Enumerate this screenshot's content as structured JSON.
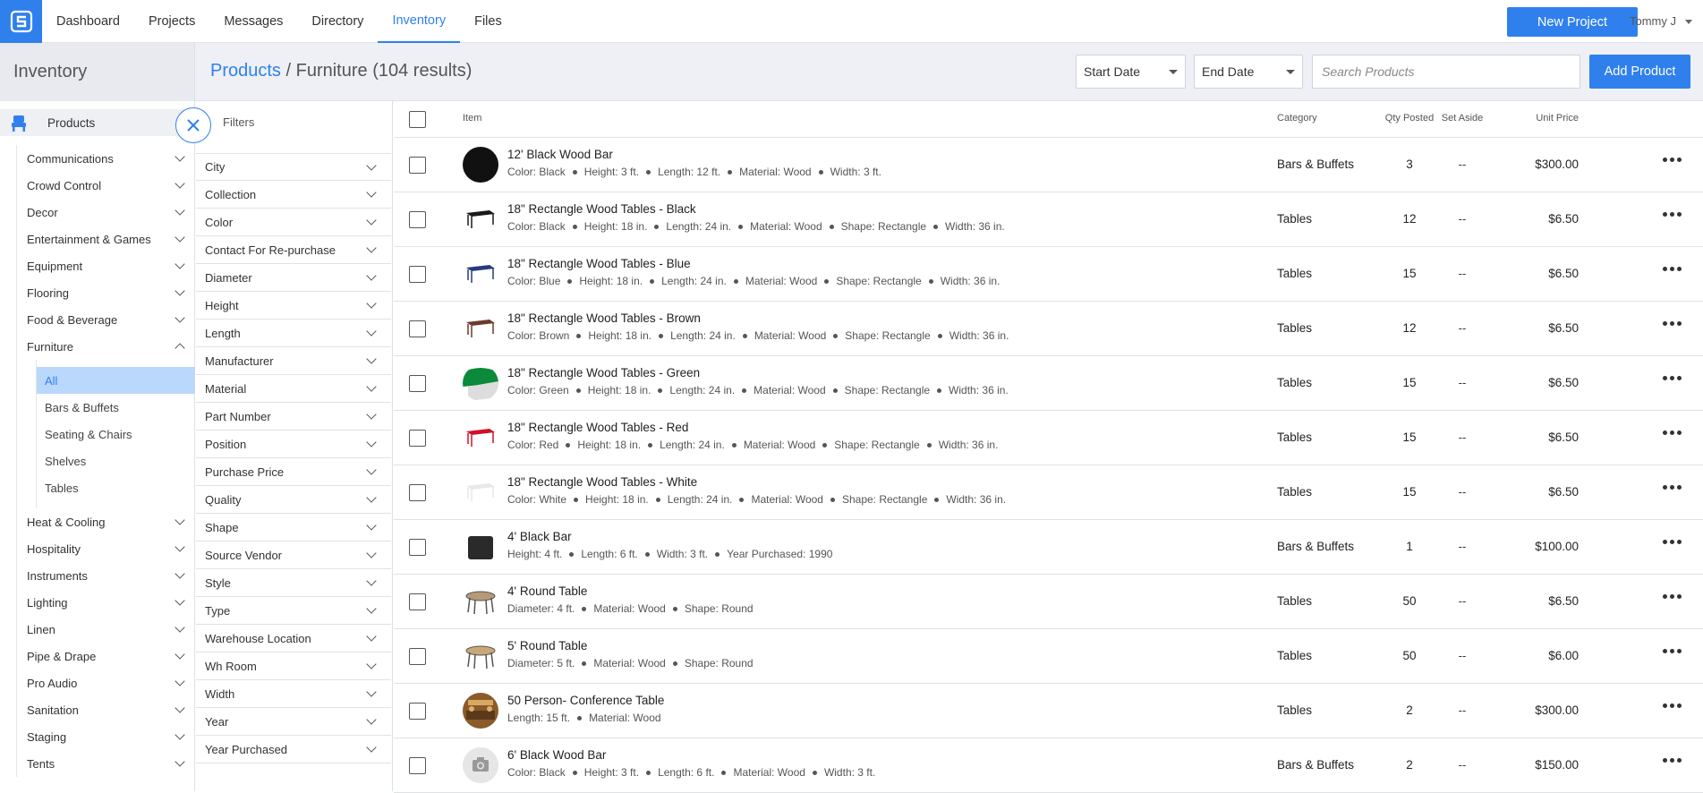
{
  "nav": {
    "items": [
      "Dashboard",
      "Projects",
      "Messages",
      "Directory",
      "Inventory",
      "Files"
    ],
    "active": "Inventory",
    "new_project": "New Project",
    "user": "Tommy J"
  },
  "page": {
    "section_title": "Inventory",
    "breadcrumb_link": "Products",
    "breadcrumb_sep": " / ",
    "breadcrumb_current": "Furniture (104 results)",
    "start_date": "Start Date",
    "end_date": "End Date",
    "search_placeholder": "Search Products",
    "add_product": "Add Product"
  },
  "sidebar": {
    "products_label": "Products",
    "categories_top": [
      "Communications",
      "Crowd Control",
      "Decor",
      "Entertainment & Games",
      "Equipment",
      "Flooring",
      "Food & Beverage",
      "Furniture"
    ],
    "furniture_sub": [
      "All",
      "Bars & Buffets",
      "Seating & Chairs",
      "Shelves",
      "Tables"
    ],
    "categories_bottom": [
      "Heat & Cooling",
      "Hospitality",
      "Instruments",
      "Lighting",
      "Linen",
      "Pipe & Drape",
      "Pro Audio",
      "Sanitation",
      "Staging",
      "Tents"
    ]
  },
  "filters": {
    "title": "Filters",
    "items": [
      "City",
      "Collection",
      "Color",
      "Contact For Re-purchase",
      "Diameter",
      "Height",
      "Length",
      "Manufacturer",
      "Material",
      "Part Number",
      "Position",
      "Purchase Price",
      "Quality",
      "Shape",
      "Source Vendor",
      "Style",
      "Type",
      "Warehouse Location",
      "Wh Room",
      "Width",
      "Year",
      "Year Purchased"
    ]
  },
  "table": {
    "headers": {
      "item": "Item",
      "category": "Category",
      "qty": "Qty Posted",
      "set_aside": "Set Aside",
      "price": "Unit Price"
    },
    "rows": [
      {
        "name": "12' Black Wood Bar",
        "attrs": [
          "Color: Black",
          "Height: 3 ft.",
          "Length: 12 ft.",
          "Material: Wood",
          "Width: 3 ft."
        ],
        "category": "Bars & Buffets",
        "qty": "3",
        "set_aside": "--",
        "price": "$300.00",
        "thumb": "black-bar",
        "color": "#111111"
      },
      {
        "name": "18\" Rectangle Wood Tables - Black",
        "attrs": [
          "Color: Black",
          "Height: 18 in.",
          "Length: 24 in.",
          "Material: Wood",
          "Shape: Rectangle",
          "Width: 36 in."
        ],
        "category": "Tables",
        "qty": "12",
        "set_aside": "--",
        "price": "$6.50",
        "thumb": "table",
        "color": "#1a1a1a"
      },
      {
        "name": "18\" Rectangle Wood Tables - Blue",
        "attrs": [
          "Color: Blue",
          "Height: 18 in.",
          "Length: 24 in.",
          "Material: Wood",
          "Shape: Rectangle",
          "Width: 36 in."
        ],
        "category": "Tables",
        "qty": "15",
        "set_aside": "--",
        "price": "$6.50",
        "thumb": "table",
        "color": "#2a3a7a"
      },
      {
        "name": "18\" Rectangle Wood Tables - Brown",
        "attrs": [
          "Color: Brown",
          "Height: 18 in.",
          "Length: 24 in.",
          "Material: Wood",
          "Shape: Rectangle",
          "Width: 36 in."
        ],
        "category": "Tables",
        "qty": "12",
        "set_aside": "--",
        "price": "$6.50",
        "thumb": "table",
        "color": "#6b3a2a"
      },
      {
        "name": "18\" Rectangle Wood Tables - Green",
        "attrs": [
          "Color: Green",
          "Height: 18 in.",
          "Length: 24 in.",
          "Material: Wood",
          "Shape: Rectangle",
          "Width: 36 in."
        ],
        "category": "Tables",
        "qty": "15",
        "set_aside": "--",
        "price": "$6.50",
        "thumb": "table-green",
        "color": "#0a8a3a"
      },
      {
        "name": "18\" Rectangle Wood Tables - Red",
        "attrs": [
          "Color: Red",
          "Height: 18 in.",
          "Length: 24 in.",
          "Material: Wood",
          "Shape: Rectangle",
          "Width: 36 in."
        ],
        "category": "Tables",
        "qty": "15",
        "set_aside": "--",
        "price": "$6.50",
        "thumb": "table",
        "color": "#d0102a"
      },
      {
        "name": "18\" Rectangle Wood Tables - White",
        "attrs": [
          "Color: White",
          "Height: 18 in.",
          "Length: 24 in.",
          "Material: Wood",
          "Shape: Rectangle",
          "Width: 36 in."
        ],
        "category": "Tables",
        "qty": "15",
        "set_aside": "--",
        "price": "$6.50",
        "thumb": "table",
        "color": "#e8e8e8"
      },
      {
        "name": "4' Black Bar",
        "attrs": [
          "Height: 4 ft.",
          "Length: 6 ft.",
          "Width: 3 ft.",
          "Year Purchased: 1990"
        ],
        "category": "Bars & Buffets",
        "qty": "1",
        "set_aside": "--",
        "price": "$100.00",
        "thumb": "box",
        "color": "#2a2a2a"
      },
      {
        "name": "4' Round Table",
        "attrs": [
          "Diameter: 4 ft.",
          "Material: Wood",
          "Shape: Round"
        ],
        "category": "Tables",
        "qty": "50",
        "set_aside": "--",
        "price": "$6.50",
        "thumb": "round",
        "color": "#b59a78"
      },
      {
        "name": "5' Round Table",
        "attrs": [
          "Diameter: 5 ft.",
          "Material: Wood",
          "Shape: Round"
        ],
        "category": "Tables",
        "qty": "50",
        "set_aside": "--",
        "price": "$6.00",
        "thumb": "round",
        "color": "#c9a878"
      },
      {
        "name": "50 Person- Conference Table",
        "attrs": [
          "Length: 15 ft.",
          "Material: Wood"
        ],
        "category": "Tables",
        "qty": "2",
        "set_aside": "--",
        "price": "$300.00",
        "thumb": "photo",
        "color": "#8a5a2a"
      },
      {
        "name": "6' Black Wood Bar",
        "attrs": [
          "Color: Black",
          "Height: 3 ft.",
          "Length: 6 ft.",
          "Material: Wood",
          "Width: 3 ft."
        ],
        "category": "Bars & Buffets",
        "qty": "2",
        "set_aside": "--",
        "price": "$150.00",
        "thumb": "camera",
        "color": "#999999"
      }
    ]
  },
  "colors": {
    "accent": "#2f80ed",
    "active_sub_bg": "#b9d8fb",
    "header_bg": "#eef0f5"
  }
}
